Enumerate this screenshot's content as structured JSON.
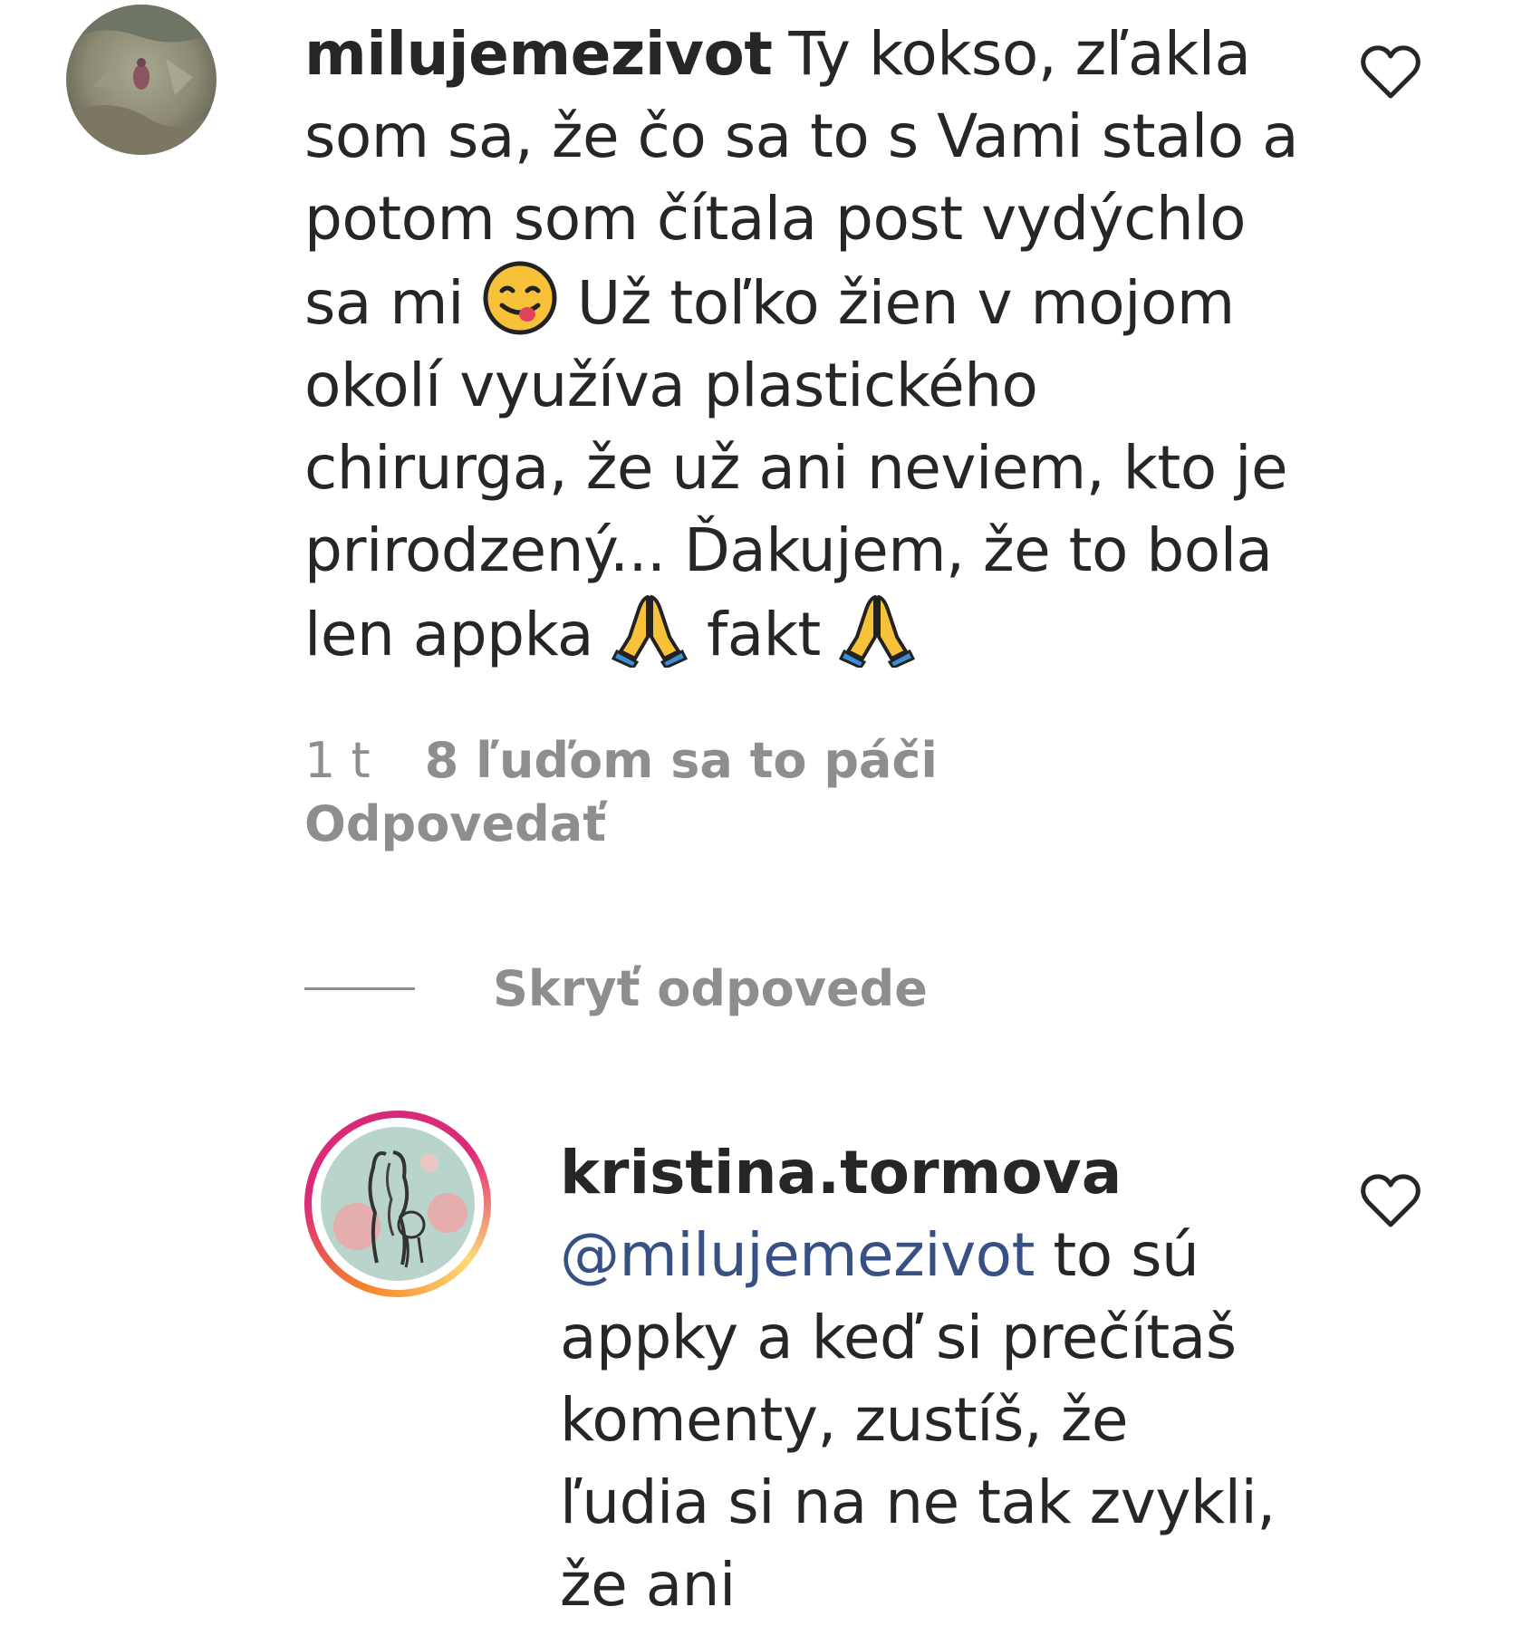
{
  "comment": {
    "username": "milujemezivot",
    "text_part1": "Ty kokso, zľakla som sa, že čo sa to s Vami stalo a potom som čítala post vydýchlo sa mi ",
    "emoji1": "face-savoring-food-emoji",
    "text_part2": " Už toľko žien v mojom okolí využíva plastického chirurga, že už ani neviem, kto je prirodzený... Ďakujem, že to bola len appka ",
    "emoji2": "folded-hands-emoji",
    "text_part3": " fakt ",
    "emoji3": "folded-hands-emoji",
    "time": "1 t",
    "likes": "8 ľuďom sa to páči",
    "reply_label": "Odpovedať",
    "heart_icon": "heart-outline-icon"
  },
  "replies_toggle": {
    "label": "Skryť odpovede"
  },
  "reply": {
    "username": "kristina.tormova",
    "mention": "@milujemezivot",
    "text": " to sú appky a keď si prečítaš komenty, zustíš, že ľudia si na ne tak zvykli, že ani",
    "heart_icon": "heart-outline-icon"
  },
  "colors": {
    "text": "#262626",
    "muted": "#8e8e8e",
    "mention": "#385185",
    "story_ring_start": "#f58529",
    "story_ring_end": "#dd2a7b"
  }
}
